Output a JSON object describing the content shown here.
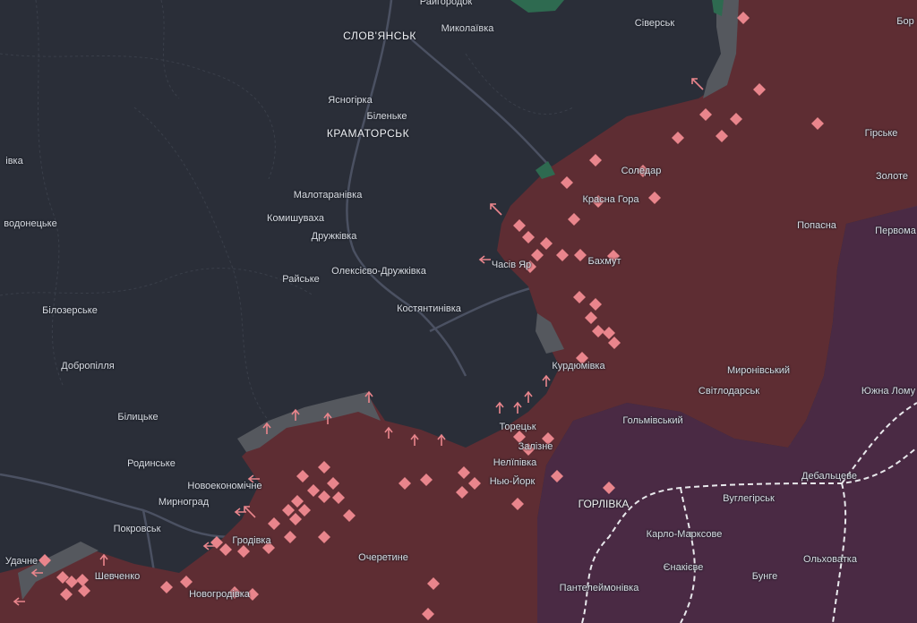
{
  "colors": {
    "background": "#2a2e38",
    "occupied_since_2022": "#5e2d33",
    "occupied_before_2022": "#4a2a44",
    "contested": "#55585e",
    "ukraine_hold_green": "#2e6a50",
    "marker": "#e9858c"
  },
  "labels": {
    "slovyansk": "СЛОВ'ЯНСЬК",
    "mykolaivka": "Миколаївка",
    "siversk": "Сіверськ",
    "yasnohirka": "Ясногірка",
    "bilenke": "Біленьке",
    "kramatorsk": "КРАМАТОРСЬК",
    "malotaranivka": "Малотаранівка",
    "komyshuvakha": "Комишуваха",
    "druzhkivka": "Дружківка",
    "oleksiievo": "Олексієво-Дружківка",
    "raiske": "Райське",
    "kostiantynivka": "Костянтинівка",
    "bilozerske": "Білозерське",
    "dobropillia": "Добропілля",
    "bilytske": "Білицьке",
    "rodynske": "Родинське",
    "novoekonomichne": "Новоекономічне",
    "myrnohrad": "Мирноград",
    "pokrovsk": "Покровськ",
    "udachne": "Удачне",
    "shevchenko": "Шевченко",
    "hrodivka": "Гродівка",
    "novohrodivka": "Новогродівка",
    "ocheretyne": "Очеретине",
    "soledar": "Соледар",
    "krasna_hora": "Красна Гора",
    "chasiv_yar": "Часів Яр",
    "bakhmut": "Бахмут",
    "kurdiumivka": "Курдюмівка",
    "toretsk": "Торецьк",
    "zalizne": "Залізне",
    "neliepivka": "Нелїпівка",
    "niu_york": "Нью-Йорк",
    "horlivka": "ГОРЛІВКА",
    "holmivskyi": "Гольмівський",
    "svitlodarsk": "Світлодарськ",
    "myronivskyi": "Миронівський",
    "popasna": "Попасна",
    "hirske": "Гірське",
    "zolote": "Золоте",
    "pervomaisk": "Первома",
    "yuzhna_lomuvatka": "Южна Лому",
    "debaltseve": "Дебальцеве",
    "vuhlehirsk": "Вуглегірськ",
    "karlo_marksove": "Карло-Марксове",
    "yenakiieve": "Єнакієве",
    "bunhe": "Бунге",
    "olkhovatka": "Ольховатка",
    "panteleimonivka": "Пантелеймонівка",
    "rivne_edge": "івка",
    "vodonetske_edge": "водонецьке",
    "borova_edge": "Бор",
    "top_edge": "Райгородок"
  }
}
